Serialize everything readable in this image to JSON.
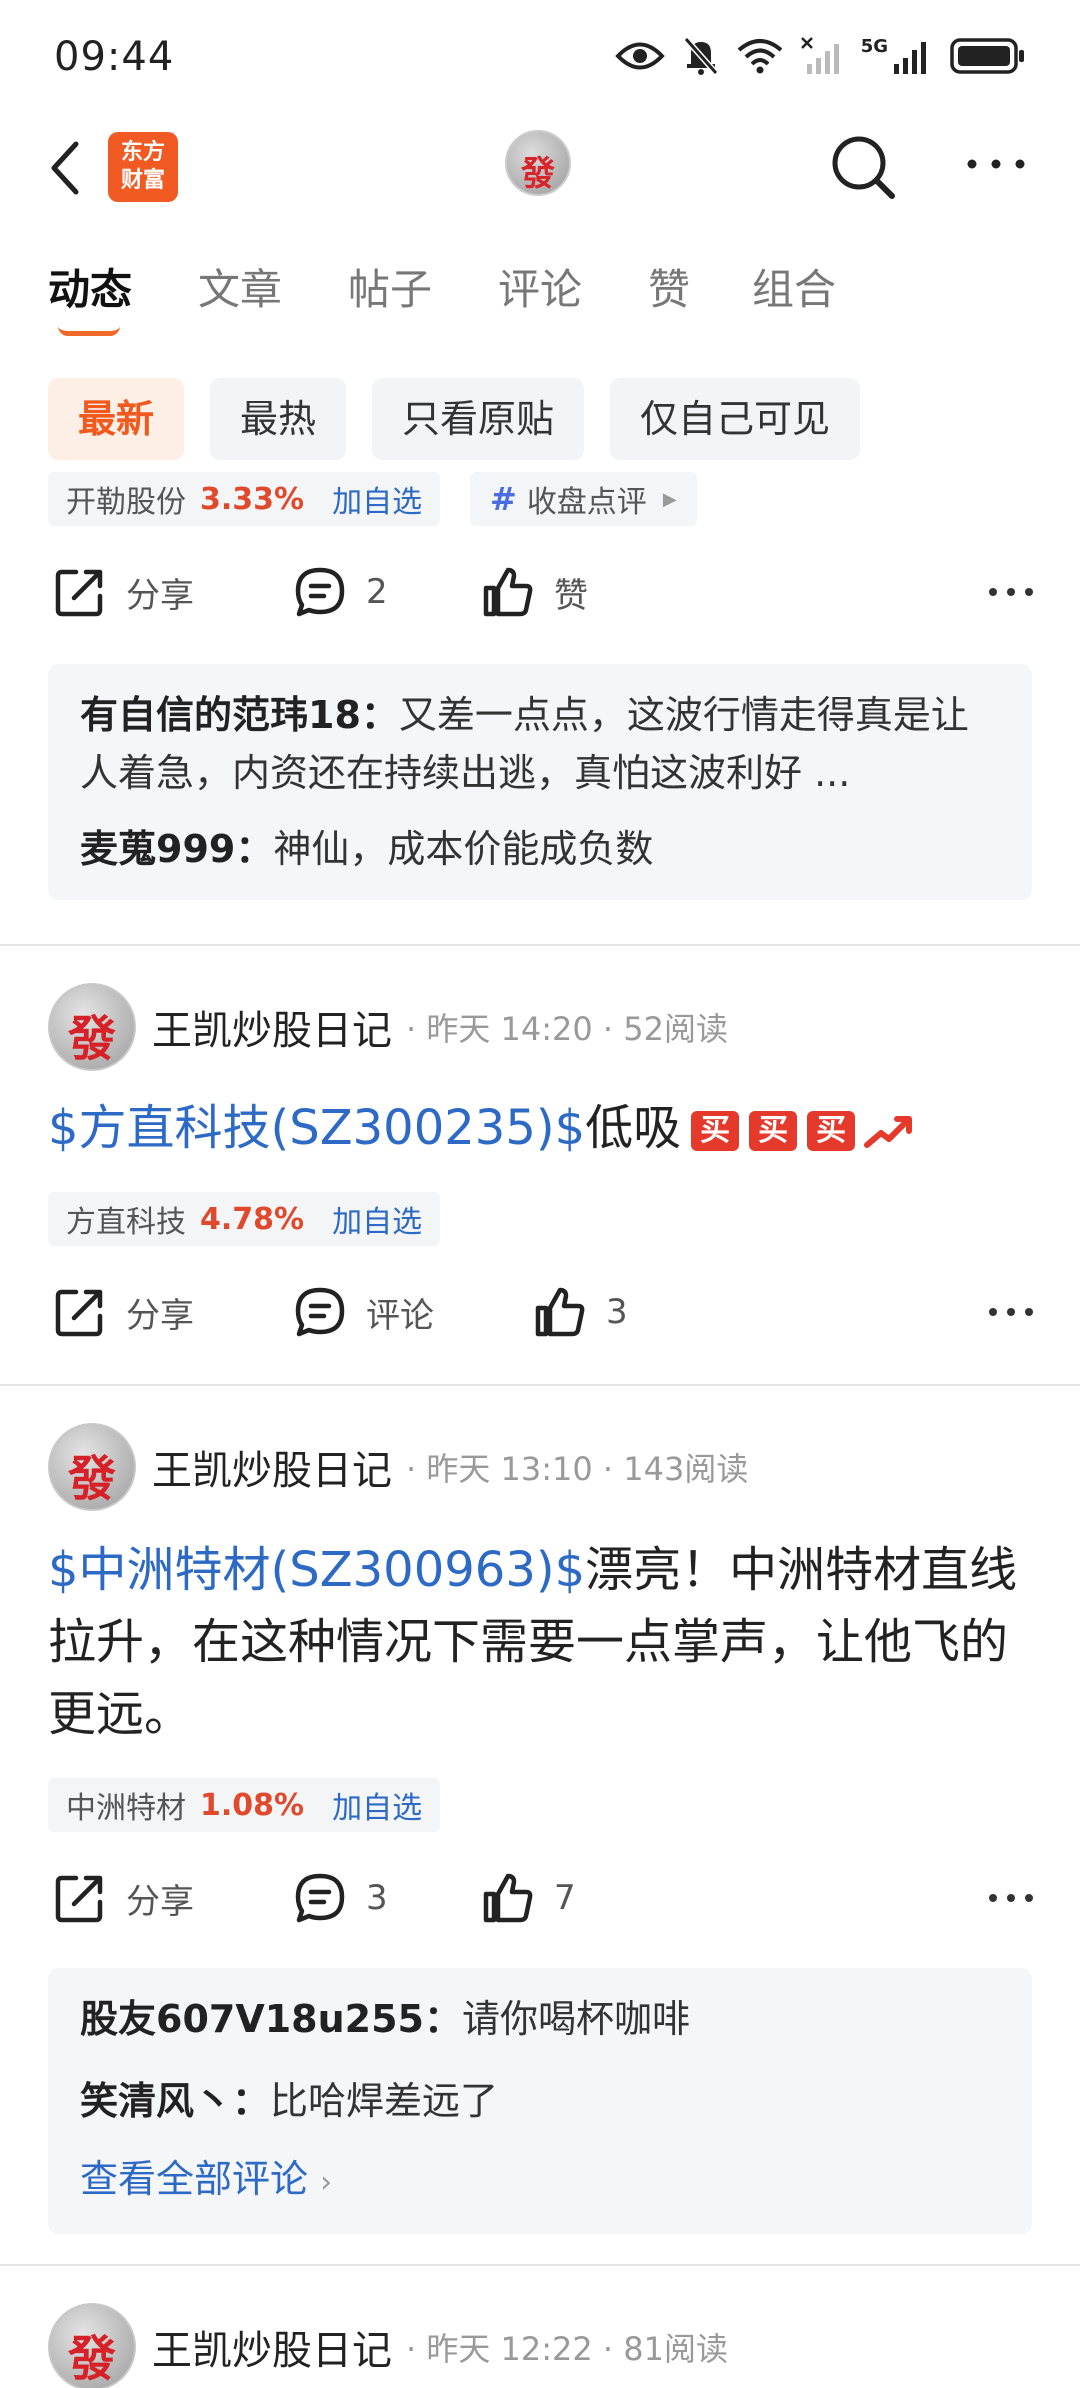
{
  "status_bar": {
    "time": "09:44",
    "network": "5G"
  },
  "header": {
    "brand_line1": "东方",
    "brand_line2": "财富",
    "avatar_char": "發"
  },
  "tabs": [
    "动态",
    "文章",
    "帖子",
    "评论",
    "赞",
    "组合"
  ],
  "filters": [
    "最新",
    "最热",
    "只看原贴",
    "仅自己可见"
  ],
  "colors": {
    "accent": "#f05a1e",
    "link": "#2d6ac5",
    "up": "#e0492c"
  },
  "post0": {
    "stock_name": "开勒股份",
    "stock_pct": "3.33%",
    "add_label": "加自选",
    "tag": "收盘点评",
    "share_label": "分享",
    "comment_count": "2",
    "like_label": "赞",
    "comments": [
      {
        "user": "有自信的范玮18",
        "sep": "：",
        "text": "又差一点点，这波行情走得真是让人着急，内资还在持续出逃，真怕这波利好 ..."
      },
      {
        "user": "麦蒐999",
        "sep": "：",
        "text": "神仙，成本价能成负数"
      }
    ]
  },
  "post1": {
    "author": "王凯炒股日记",
    "meta": "· 昨天 14:20 · 52阅读",
    "stock_text": "$方直科技(SZ300235)$",
    "body": "低吸",
    "emoji": [
      "买",
      "买",
      "买"
    ],
    "stock_name": "方直科技",
    "stock_pct": "4.78%",
    "add_label": "加自选",
    "share_label": "分享",
    "comment_label": "评论",
    "like_count": "3"
  },
  "post2": {
    "author": "王凯炒股日记",
    "meta": "· 昨天 13:10 · 143阅读",
    "stock_text": "$中洲特材(SZ300963)$",
    "body": "漂亮！中洲特材直线拉升，在这种情况下需要一点掌声，让他飞的更远。",
    "stock_name": "中洲特材",
    "stock_pct": "1.08%",
    "add_label": "加自选",
    "share_label": "分享",
    "comment_count": "3",
    "like_count": "7",
    "comments": [
      {
        "user": "股友607V18u255",
        "sep": "：",
        "text": "请你喝杯咖啡"
      },
      {
        "user": "笑清风丶",
        "sep": "：",
        "text": "比哈焊差远了"
      }
    ],
    "view_all": "查看全部评论"
  },
  "post3": {
    "author": "王凯炒股日记",
    "meta": "· 昨天 12:22 · 81阅读"
  }
}
